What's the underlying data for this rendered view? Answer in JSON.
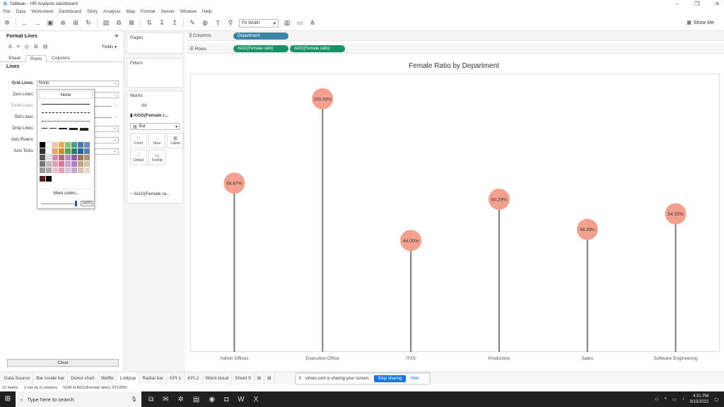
{
  "window": {
    "title": "Tableau - HR Analysis dashboard"
  },
  "menu": [
    "File",
    "Data",
    "Worksheet",
    "Dashboard",
    "Story",
    "Analysis",
    "Map",
    "Format",
    "Server",
    "Window",
    "Help"
  ],
  "toolbar": {
    "fit": "Fit Width",
    "show_me": "Show Me"
  },
  "format_pane": {
    "title": "Format Lines",
    "fields": "Fields ▾",
    "tabs": [
      "Sheet",
      "Rows",
      "Columns"
    ],
    "section": "Lines",
    "rows": [
      {
        "label": "Grid Lines:",
        "value": "None"
      },
      {
        "label": "Zero Lines:",
        "value": ""
      },
      {
        "label": "Trend Lines:",
        "value": ""
      },
      {
        "label": "Ref Lines:",
        "value": ""
      },
      {
        "label": "Drop Lines:",
        "value": ""
      },
      {
        "label": "Axis Rulers:",
        "value": ""
      },
      {
        "label": "Axis Ticks:",
        "value": ""
      }
    ],
    "dropdown": {
      "none": "None",
      "more_colors": "More colors...",
      "opacity": "100%"
    },
    "clear": "Clear"
  },
  "shelves": {
    "pages": "Pages",
    "filters": "Filters",
    "marks": "Marks",
    "marks_all": "All",
    "marks_agg": "AGG(Female r...",
    "mark_type": "Bar",
    "mark_buttons": [
      "Color",
      "Size",
      "Label",
      "Detail",
      "Tooltip"
    ],
    "marks_agg2": "AGG(Female ra...",
    "columns_label": "Columns",
    "rows_label": "Rows",
    "columns_pill": "Department",
    "rows_pills": [
      "AGG(Female ratio)",
      "AGG(Female ratio)"
    ]
  },
  "chart_data": {
    "type": "bar",
    "title": "Female Ratio by Department",
    "categories": [
      "Admin Offices",
      "Executive Office",
      "IT/IS",
      "Production",
      "Sales",
      "Software Engineering"
    ],
    "values": [
      66.67,
      100.0,
      44.0,
      60.29,
      48.39,
      54.55
    ],
    "labels": [
      "66.67%",
      "100.00%",
      "44.00%",
      "60.29%",
      "48.39%",
      "54.55%"
    ],
    "ylim": [
      0,
      110
    ],
    "grid": false,
    "stem_color": "#7a7a7a",
    "dot_color": "#f4a08f"
  },
  "sheets": [
    "Data Source",
    "Bar inside bar",
    "Donut chart",
    "Waffle",
    "Lollipop",
    "Radial bar",
    "KPI-1",
    "KPI-2",
    "Word cloud",
    "Sheet 9"
  ],
  "active_sheet": "Lollipop",
  "share": {
    "text": "vimeo.com is sharing your screen.",
    "stop": "Stop sharing",
    "hide": "Hide"
  },
  "status": [
    "12 marks",
    "1 row by 6 columns",
    "SUM of AGG(Female ratio): 373.89%"
  ],
  "taskbar": {
    "search": "Type here to search",
    "time": "4:31 PM",
    "date": "9/15/2022"
  }
}
